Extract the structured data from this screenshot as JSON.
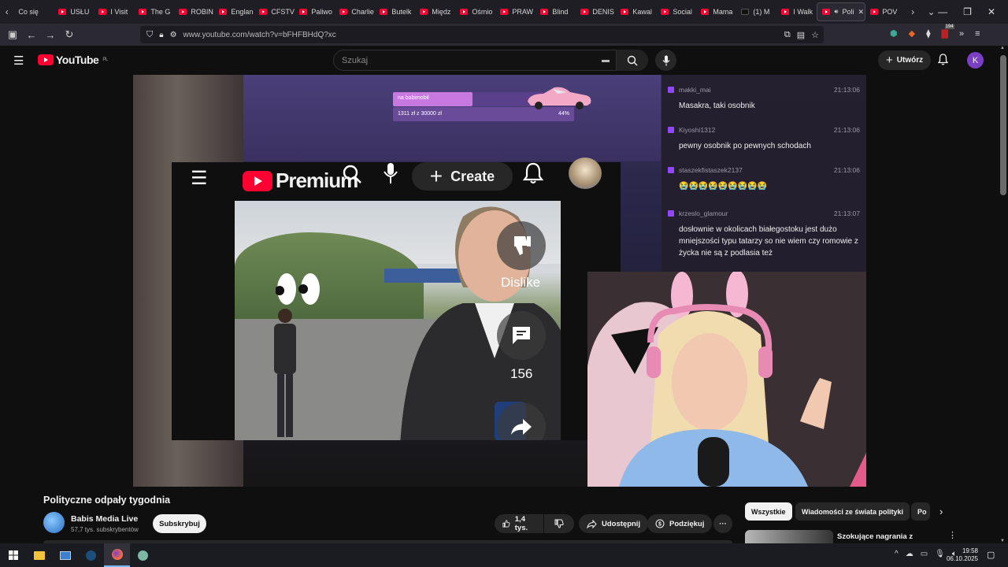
{
  "browser": {
    "tabs": [
      {
        "label": "Co się",
        "fav": "none"
      },
      {
        "label": "USŁU",
        "fav": "yt"
      },
      {
        "label": "I Visit",
        "fav": "yt"
      },
      {
        "label": "The G",
        "fav": "yt"
      },
      {
        "label": "ROBIN",
        "fav": "yt"
      },
      {
        "label": "Englan",
        "fav": "yt"
      },
      {
        "label": "CFSTV",
        "fav": "yt"
      },
      {
        "label": "Paliwo",
        "fav": "yt"
      },
      {
        "label": "Charlie",
        "fav": "yt"
      },
      {
        "label": "Butelk",
        "fav": "yt"
      },
      {
        "label": "Międz",
        "fav": "yt"
      },
      {
        "label": "Ośmio",
        "fav": "yt"
      },
      {
        "label": "PRAW",
        "fav": "yt"
      },
      {
        "label": "Blind",
        "fav": "yt"
      },
      {
        "label": "DENIS",
        "fav": "yt"
      },
      {
        "label": "Kawal",
        "fav": "yt"
      },
      {
        "label": "Social",
        "fav": "yt"
      },
      {
        "label": "Mama",
        "fav": "yt"
      },
      {
        "label": "(1) M",
        "fav": "x"
      },
      {
        "label": "I Walk",
        "fav": "yt"
      },
      {
        "label": "Poli",
        "fav": "yt",
        "active": true
      },
      {
        "label": "POV",
        "fav": "yt"
      }
    ],
    "url": "www.youtube.com/watch?v=bFHFBHdQ?xc",
    "extension_badge": "194"
  },
  "youtube": {
    "logo_text": "YouTube",
    "logo_region": "PL",
    "search_placeholder": "Szukaj",
    "create_label": "Utwórz",
    "avatar_letter": "K"
  },
  "video": {
    "donation": {
      "label": "na babimobil",
      "progress_text": "1311 zł z 30000 zł",
      "percent_text": "44%",
      "fill_fraction": 0.44
    },
    "inner": {
      "logo_text": "Premium",
      "create_label": "Create",
      "dislike_label": "Dislike",
      "comment_count": "156"
    },
    "chat": [
      {
        "user": "makki_mai",
        "time": "21:13:06",
        "text": "Masakra, taki osobnik"
      },
      {
        "user": "Kiyoshi1312",
        "time": "21:13:06",
        "text": "pewny osobnik po pewnych schodach"
      },
      {
        "user": "staszekfistaszek2137",
        "time": "21:13:06",
        "text": "😭😭😭😭😭😭😭😭😭"
      },
      {
        "user": "krzeslo_glamour",
        "time": "21:13:07",
        "text": "dosłownie w okolicach białegostoku jest dużo mniejszości typu tatarzy so nie wiem czy romowie z życka nie są z podlasia też"
      }
    ]
  },
  "details": {
    "title": "Polityczne odpały tygodnia",
    "channel": "Babis Media Live",
    "subscribers": "57,7 tys. subskrybentów",
    "subscribe_label": "Subskrybuj",
    "likes": "1,4 tys.",
    "share_label": "Udostępnij",
    "thanks_label": "Podziękuj"
  },
  "chips": [
    "Wszystkie",
    "Wiadomości ze świata polityki",
    "Po"
  ],
  "recommendation": {
    "title": "Szokujące nagrania z więzienia. Rodziny domagają się"
  },
  "taskbar": {
    "time": "19:58",
    "date": "06.10.2025"
  },
  "colors": {
    "youtube_red": "#ff0033",
    "background": "#0f0f0f",
    "twitch_purple": "#9146ff"
  }
}
